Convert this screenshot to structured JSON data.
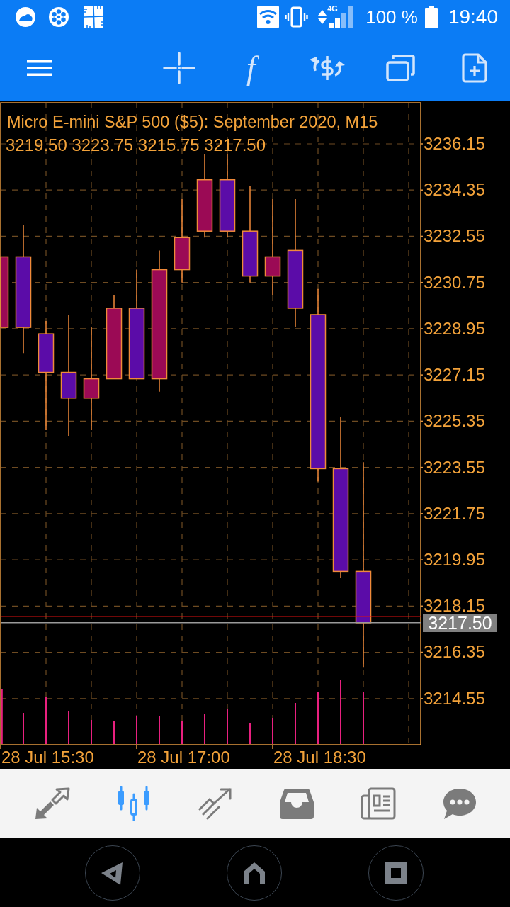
{
  "status_bar": {
    "network": "4G",
    "battery": "100 %",
    "time": "19:40"
  },
  "toolbar": {
    "indicators": "f"
  },
  "chart": {
    "title": "Micro E-mini S&P 500 ($5): September 2020, M15",
    "ohlc": "3219.50 3223.75 3215.75 3217.50",
    "price_axis": [
      "3236.15",
      "3234.35",
      "3232.55",
      "3230.75",
      "3228.95",
      "3227.15",
      "3225.35",
      "3223.55",
      "3221.75",
      "3219.95",
      "3218.15",
      "3216.35",
      "3214.55"
    ],
    "current_price": "3217.50",
    "time_axis": [
      "28 Jul 15:30",
      "28 Jul 17:00",
      "28 Jul 18:30"
    ]
  },
  "bottom_tabs": [
    {
      "selected": false
    },
    {
      "selected": true
    },
    {
      "selected": false
    },
    {
      "selected": false
    },
    {
      "selected": false
    },
    {
      "selected": false
    }
  ]
}
